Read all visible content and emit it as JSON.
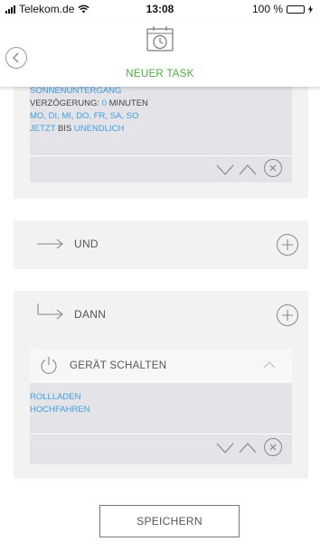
{
  "status_bar": {
    "carrier": "Telekom.de",
    "time": "13:08",
    "battery": "100 %",
    "battery_level": 1.0
  },
  "header": {
    "title": "NEUER TASK"
  },
  "trigger": {
    "event": "SONNENUNTERGANG",
    "delay_label": "VERZÖGERUNG:",
    "delay_value": "0",
    "delay_unit": "MINUTEN",
    "days": "MO, DI, MI, DO, FR, SA, SO",
    "from": "JETZT",
    "until_label": "BIS",
    "until": "UNENDLICH"
  },
  "und_row": {
    "label": "UND"
  },
  "dann_row": {
    "label": "DANN"
  },
  "action": {
    "title": "GERÄT SCHALTEN",
    "device": "ROLLLADEN",
    "command": "HOCHFAHREN"
  },
  "save_label": "SPEICHERN",
  "colors": {
    "accent_green": "#4cae3c",
    "link_blue": "#3f9ee2",
    "panel_bg": "#f2f2f2",
    "inner_bg": "#e4e4e8"
  }
}
